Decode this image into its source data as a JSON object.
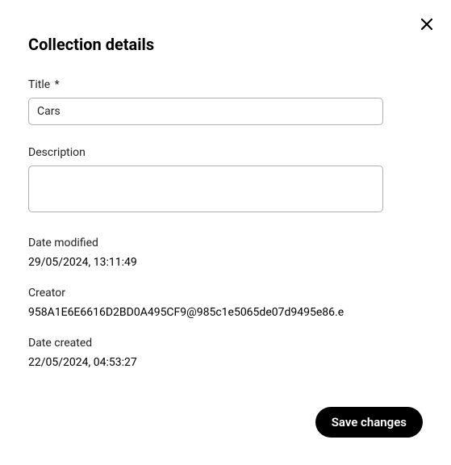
{
  "dialog": {
    "heading": "Collection details",
    "close_label": "Close"
  },
  "fields": {
    "title": {
      "label": "Title",
      "required_mark": "*",
      "value": "Cars"
    },
    "description": {
      "label": "Description",
      "value": ""
    }
  },
  "meta": {
    "date_modified": {
      "label": "Date modified",
      "value": "29/05/2024, 13:11:49"
    },
    "creator": {
      "label": "Creator",
      "value": "958A1E6E6616D2BD0A495CF9@985c1e5065de07d9495e86.e"
    },
    "date_created": {
      "label": "Date created",
      "value": "22/05/2024, 04:53:27"
    }
  },
  "actions": {
    "save_label": "Save changes"
  }
}
